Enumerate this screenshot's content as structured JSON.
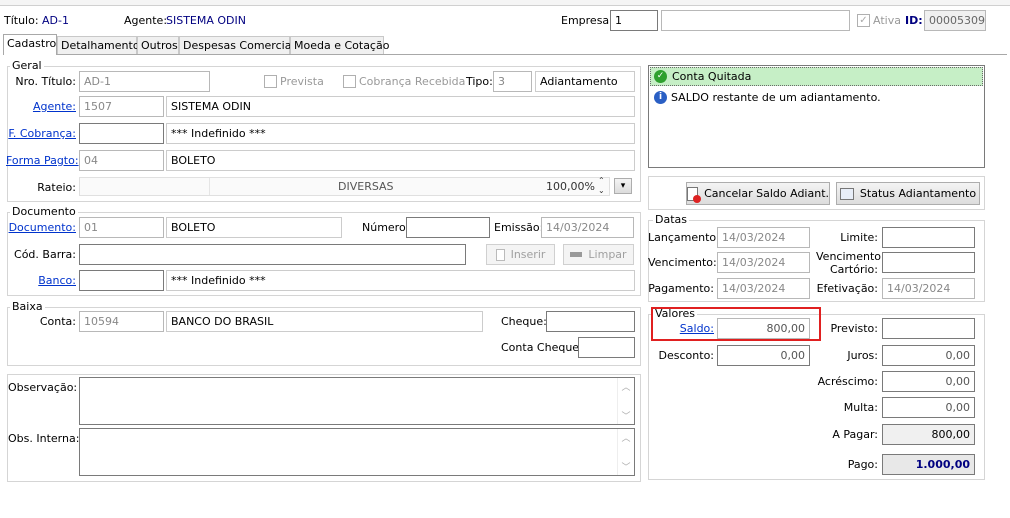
{
  "header": {
    "titulo_label": "Título:",
    "titulo_value": "AD-1",
    "agente_label": "Agente:",
    "agente_value": "SISTEMA ODIN",
    "empresa_label": "Empresa:",
    "empresa_value": "1",
    "ativa_label": "Ativa",
    "id_label": "ID:",
    "id_value": "00005309"
  },
  "tabs": [
    "Cadastro",
    "Detalhamento",
    "Outros",
    "Despesas Comerciais",
    "Moeda e Cotação"
  ],
  "geral": {
    "title": "Geral",
    "nro_titulo_label": "Nro. Título:",
    "nro_titulo_value": "AD-1",
    "prevista_label": "Prevista",
    "cobranca_recebida_label": "Cobrança Recebida",
    "tipo_label": "Tipo:",
    "tipo_code": "3",
    "tipo_name": "Adiantamento",
    "agente_label": "Agente:",
    "agente_code": "1507",
    "agente_name": "SISTEMA ODIN",
    "f_cobranca_label": "F. Cobrança:",
    "f_cobranca_code": "",
    "f_cobranca_name": "*** Indefinido ***",
    "forma_pagto_label": "Forma Pagto:",
    "forma_pagto_code": "04",
    "forma_pagto_name": "BOLETO",
    "rateio_label": "Rateio:",
    "rateio_value": "DIVERSAS",
    "rateio_pct": "100,00%"
  },
  "documento": {
    "title": "Documento",
    "documento_label": "Documento:",
    "documento_code": "01",
    "documento_name": "BOLETO",
    "numero_label": "Número:",
    "numero_value": "",
    "emissao_label": "Emissão:",
    "emissao_value": "14/03/2024",
    "cod_barra_label": "Cód. Barra:",
    "cod_barra_value": "",
    "inserir_label": "Inserir",
    "limpar_label": "Limpar",
    "banco_label": "Banco:",
    "banco_code": "",
    "banco_name": "*** Indefinido ***"
  },
  "baixa": {
    "title": "Baixa",
    "conta_label": "Conta:",
    "conta_code": "10594",
    "conta_name": "BANCO DO BRASIL",
    "cheque_label": "Cheque:",
    "cheque_value": "",
    "conta_cheque_label": "Conta Cheque:",
    "conta_cheque_value": ""
  },
  "obs": {
    "observacao_label": "Observação:",
    "obs_interna_label": "Obs. Interna:"
  },
  "status": {
    "conta_quitada": "Conta Quitada",
    "saldo_info": "SALDO restante de um adiantamento.",
    "quitada_color": "#c6efc6"
  },
  "buttons": {
    "cancelar_saldo": "Cancelar Saldo Adiant.",
    "status_adiantamento": "Status Adiantamento"
  },
  "datas": {
    "title": "Datas",
    "lancamento_label": "Lançamento:",
    "lancamento_value": "14/03/2024",
    "limite_label": "Limite:",
    "limite_value": "",
    "vencimento_label": "Vencimento:",
    "vencimento_value": "14/03/2024",
    "venc_cartorio_label_1": "Vencimento",
    "venc_cartorio_label_2": "Cartório:",
    "venc_cartorio_value": "",
    "pagamento_label": "Pagamento:",
    "pagamento_value": "14/03/2024",
    "efetivacao_label": "Efetivação:",
    "efetivacao_value": "14/03/2024"
  },
  "valores": {
    "title": "Valores",
    "saldo_label": "Saldo:",
    "saldo_value": "800,00",
    "previsto_label": "Previsto:",
    "previsto_value": "",
    "desconto_label": "Desconto:",
    "desconto_value": "0,00",
    "juros_label": "Juros:",
    "juros_value": "0,00",
    "acrescimo_label": "Acréscimo:",
    "acrescimo_value": "0,00",
    "multa_label": "Multa:",
    "multa_value": "0,00",
    "a_pagar_label": "A Pagar:",
    "a_pagar_value": "800,00",
    "pago_label": "Pago:",
    "pago_value": "1.000,00",
    "highlight_color": "#e02020",
    "pago_color": "#000080"
  }
}
